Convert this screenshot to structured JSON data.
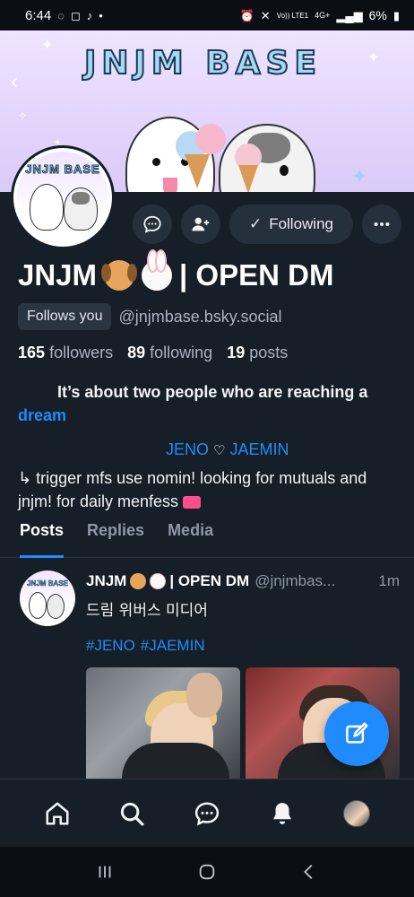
{
  "status_bar": {
    "time": "6:44",
    "left_icons": [
      "whatsapp-icon",
      "instagram-icon",
      "tiktok-icon",
      "dot-icon"
    ],
    "right_icons": [
      "alarm-icon",
      "mute-icon",
      "volte-icon",
      "signal-icon",
      "battery-icon"
    ],
    "network_volte": "Vo)) LTE1",
    "network_4g": "4G+",
    "battery": "6%"
  },
  "banner": {
    "title": "JNJM BASE",
    "back_icon": "back-arrow-icon"
  },
  "avatar": {
    "mini_title": "JNJM BASE"
  },
  "actions": {
    "message_icon": "chat-bubble-icon",
    "add_user_icon": "add-user-icon",
    "follow_icon": "check-icon",
    "follow_label": "Following",
    "more_icon": "more-horizontal-icon"
  },
  "profile": {
    "name_prefix": "JNJM",
    "name_suffix": "| OPEN DM",
    "follows_you": "Follows you",
    "handle": "@jnjmbase.bsky.social",
    "followers_count": "165",
    "followers_label": "followers",
    "following_count": "89",
    "following_label": "following",
    "posts_count": "19",
    "posts_label": "posts"
  },
  "bio": {
    "line1": "It’s about two people who are reaching a",
    "link": "dream",
    "name_a": "JENO",
    "heart": "♡",
    "name_b": "JAEMIN",
    "line3": "↳ trigger mfs use nomin! looking for mutuals and jnjm! for daily menfess"
  },
  "tabs": [
    {
      "label": "Posts",
      "active": true
    },
    {
      "label": "Replies",
      "active": false
    },
    {
      "label": "Media",
      "active": false
    }
  ],
  "post": {
    "author_prefix": "JNJM",
    "author_suffix": "| OPEN DM",
    "handle": "@jnjmbas...",
    "time": "1m",
    "text": "드림 위버스 미디어",
    "tags": [
      "#JENO",
      "#JAEMIN"
    ]
  },
  "fab": {
    "icon": "compose-icon"
  },
  "bottom_nav": [
    "home-icon",
    "search-icon",
    "chat-icon",
    "notifications-icon",
    "profile-avatar"
  ],
  "system_nav": [
    "recents-icon",
    "home-circle-icon",
    "back-chevron-icon"
  ],
  "colors": {
    "background": "#161e27",
    "accent": "#208bfe",
    "muted_text": "#aab4c0",
    "button_bg": "#25303d"
  }
}
